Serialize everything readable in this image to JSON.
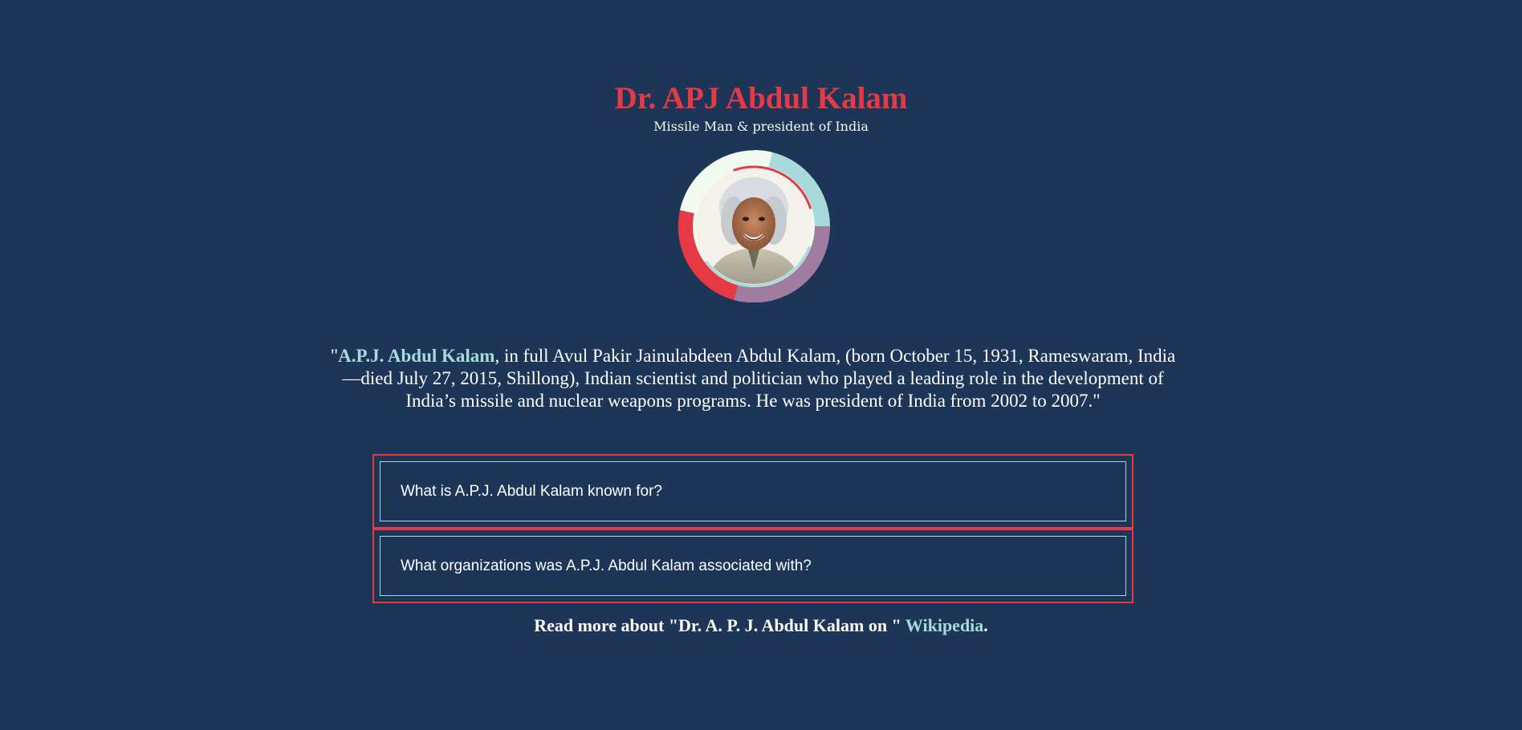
{
  "header": {
    "title": "Dr. APJ Abdul Kalam",
    "subtitle": "Missile Man & president of India"
  },
  "portrait": {
    "icon": "portrait-photo",
    "ring_colors": [
      "#f1faee",
      "#a8dadc",
      "#a07ca0",
      "#e63946"
    ]
  },
  "intro": {
    "open_quote": "\"",
    "name": "A.P.J. Abdul Kalam",
    "body": ", in full Avul Pakir Jainulabdeen Abdul Kalam, (born October 15, 1931, Rameswaram, India—died July 27, 2015, Shillong), Indian scientist and politician who played a leading role in the development of India’s missile and nuclear weapons programs. He was president of India from 2002 to 2007.",
    "close_quote": "\""
  },
  "faq": {
    "items": [
      {
        "question": "What is A.P.J. Abdul Kalam known for?"
      },
      {
        "question": "What organizations was A.P.J. Abdul Kalam associated with?"
      }
    ]
  },
  "footer": {
    "prefix": "Read more about \"Dr. A. P. J. Abdul Kalam on \" ",
    "link_text": "Wikipedia",
    "suffix": "."
  },
  "colors": {
    "background": "#1d3557",
    "accent_red": "#e63946",
    "accent_teal": "#a8dadc",
    "off_white": "#f1faee"
  }
}
